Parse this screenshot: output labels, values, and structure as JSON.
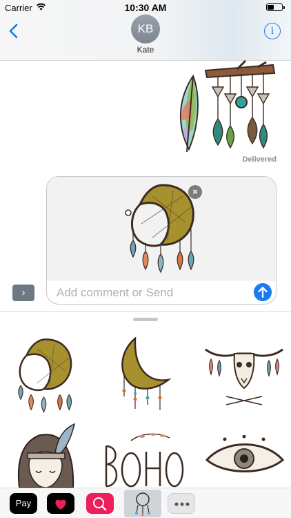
{
  "status_bar": {
    "carrier": "Carrier",
    "time": "10:30 AM"
  },
  "header": {
    "avatar_initials": "KB",
    "contact_name": "Kate",
    "info_icon": "i"
  },
  "conversation": {
    "delivered_label": "Delivered"
  },
  "compose": {
    "placeholder": "Add comment or Send",
    "expand_icon": "›"
  },
  "app_drawer": {
    "apple_pay_label": "Pay",
    "stickers": [
      "dreamcatcher-crescent-sticker",
      "crescent-moon-sticker",
      "bull-skull-wild-free-sticker",
      "boho-girl-sticker",
      "boho-lettering-sticker",
      "eye-sticker"
    ]
  },
  "colors": {
    "accent": "#1877f2",
    "send": "#1a7cf5",
    "search_app": "#ec1f5b",
    "gold": "#a7902e"
  }
}
